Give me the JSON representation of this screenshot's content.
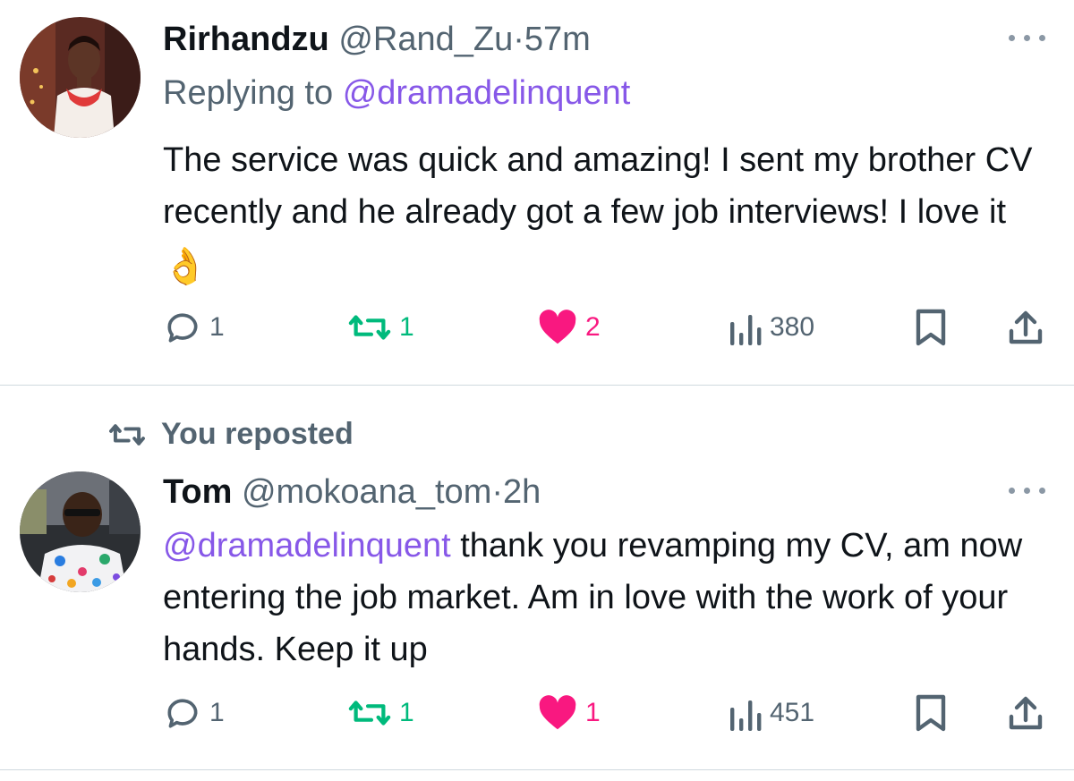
{
  "tweets": [
    {
      "display_name": "Rirhandzu",
      "handle": "@Rand_Zu",
      "dot": "·",
      "time": "57m",
      "replying_prefix": "Replying to",
      "replying_mention": "@dramadelinquent",
      "text": "The service was quick and amazing! I sent my brother CV recently and he already got a few job interviews! I love it",
      "emoji": "👌",
      "reply_count": "1",
      "retweet_count": "1",
      "like_count": "2",
      "view_count": "380"
    },
    {
      "repost_label": "You reposted",
      "display_name": "Tom",
      "handle": "@mokoana_tom",
      "dot": "·",
      "time": "2h",
      "mention": "@dramadelinquent",
      "text": " thank you revamping my CV, am now entering the job market. Am in love with the work of your hands. Keep it up",
      "reply_count": "1",
      "retweet_count": "1",
      "like_count": "1",
      "view_count": "451"
    }
  ],
  "colors": {
    "mention": "#8758e8",
    "secondary_text": "#536471",
    "retweet": "#00ba7c",
    "like": "#f91880",
    "divider": "#cfd9de"
  },
  "icons": [
    "reply-icon",
    "retweet-icon",
    "heart-icon",
    "views-icon",
    "bookmark-icon",
    "share-icon",
    "more-icon"
  ]
}
